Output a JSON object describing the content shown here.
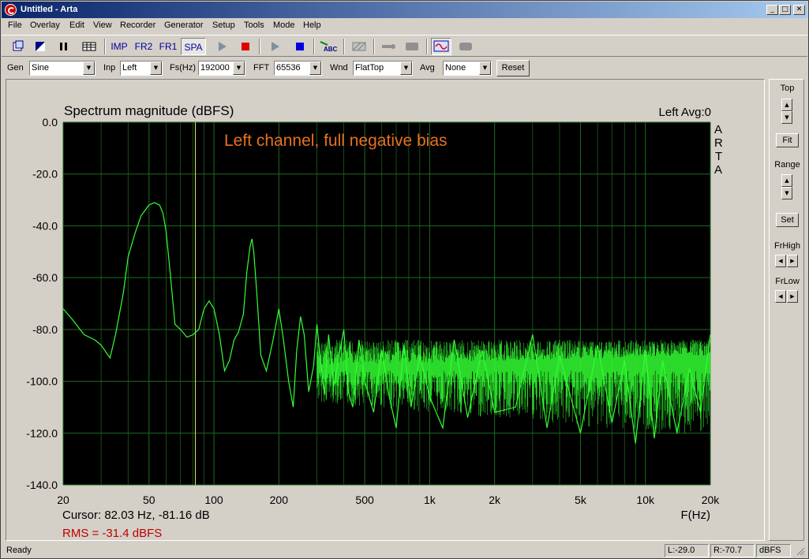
{
  "window": {
    "title": "Untitled - Arta",
    "minimize": "_",
    "maximize": "□",
    "close": "✕"
  },
  "menu": [
    "File",
    "Overlay",
    "Edit",
    "View",
    "Recorder",
    "Generator",
    "Setup",
    "Tools",
    "Mode",
    "Help"
  ],
  "toolbar": {
    "imp": "IMP",
    "fr2": "FR2",
    "fr1": "FR1",
    "spa": "SPA",
    "abc": "ABC"
  },
  "controls": {
    "gen_label": "Gen",
    "gen_value": "Sine",
    "inp_label": "Inp",
    "inp_value": "Left",
    "fs_label": "Fs(Hz)",
    "fs_value": "192000",
    "fft_label": "FFT",
    "fft_value": "65536",
    "wnd_label": "Wnd",
    "wnd_value": "FlatTop",
    "avg_label": "Avg",
    "avg_value": "None",
    "reset_label": "Reset"
  },
  "side_panel": {
    "top_label": "Top",
    "fit_label": "Fit",
    "range_label": "Range",
    "set_label": "Set",
    "frhigh_label": "FrHigh",
    "frlow_label": "FrLow"
  },
  "plot": {
    "title": "Spectrum magnitude (dBFS)",
    "channel_avg": "Left  Avg:0",
    "annotation": "Left channel, full negative bias",
    "watermark": [
      "A",
      "R",
      "T",
      "A"
    ],
    "cursor_text": "Cursor: 82.03 Hz, -81.16 dB",
    "rms_text": "RMS =  -31.4 dBFS",
    "xlabel": "F(Hz)"
  },
  "chart_data": {
    "type": "line",
    "title": "Spectrum magnitude (dBFS)",
    "xlabel": "F(Hz)",
    "ylabel": "",
    "xscale": "log",
    "xlim": [
      20,
      20000
    ],
    "ylim": [
      -140,
      0
    ],
    "yticks": [
      0,
      -20,
      -40,
      -60,
      -80,
      -100,
      -120,
      -140
    ],
    "ytick_labels": [
      "0.0",
      "-20.0",
      "-40.0",
      "-60.0",
      "-80.0",
      "-100.0",
      "-120.0",
      "-140.0"
    ],
    "xticks": [
      20,
      50,
      100,
      200,
      500,
      1000,
      2000,
      5000,
      10000,
      20000
    ],
    "xtick_labels": [
      "20",
      "50",
      "100",
      "200",
      "500",
      "1k",
      "2k",
      "5k",
      "10k",
      "20k"
    ],
    "grid": true,
    "cursor_x": 82.03,
    "line_color": "#33ff33",
    "background": "#000000",
    "grid_color": "#1f6b1f",
    "cursor_color": "#e8e07a",
    "series": [
      {
        "x": [
          20,
          22,
          25,
          28,
          30,
          33,
          35,
          38,
          40,
          43,
          46,
          50,
          53,
          56,
          58,
          60,
          63,
          66,
          70,
          75,
          80,
          85,
          90,
          95,
          100,
          106,
          112,
          118,
          124,
          130,
          137,
          142,
          147,
          150,
          153,
          158,
          165,
          175,
          188,
          200,
          210,
          222,
          233,
          242,
          252,
          262,
          275,
          290,
          300,
          312,
          325,
          340,
          360,
          380,
          400,
          420,
          440,
          470,
          500,
          550,
          600,
          650,
          700,
          760,
          820,
          900,
          1000,
          1150,
          1300,
          1500,
          1750,
          2000,
          2500,
          3000,
          3500,
          4000,
          5000,
          6000,
          7000,
          8000,
          9000,
          10000,
          11000,
          12000,
          14000,
          16000,
          18000,
          20000
        ],
        "y": [
          -72,
          -76,
          -82,
          -84,
          -86,
          -91,
          -82,
          -66,
          -52,
          -43,
          -36,
          -32,
          -31,
          -32,
          -35,
          -42,
          -60,
          -78,
          -80,
          -83,
          -82,
          -80,
          -72,
          -69,
          -72,
          -82,
          -96,
          -92,
          -84,
          -81,
          -74,
          -58,
          -48,
          -45,
          -50,
          -66,
          -90,
          -96,
          -84,
          -72,
          -84,
          -100,
          -110,
          -88,
          -75,
          -82,
          -104,
          -94,
          -78,
          -92,
          -105,
          -82,
          -102,
          -90,
          -80,
          -104,
          -110,
          -84,
          -100,
          -112,
          -88,
          -106,
          -118,
          -86,
          -110,
          -90,
          -106,
          -118,
          -84,
          -114,
          -88,
          -112,
          -110,
          -82,
          -118,
          -90,
          -120,
          -86,
          -116,
          -92,
          -124,
          -88,
          -122,
          -92,
          -120,
          -95,
          -112,
          -82
        ]
      }
    ]
  },
  "status": {
    "ready": "Ready",
    "left_level": "L:-29.0",
    "right_level": "R:-70.7",
    "unit": "dBFS"
  }
}
